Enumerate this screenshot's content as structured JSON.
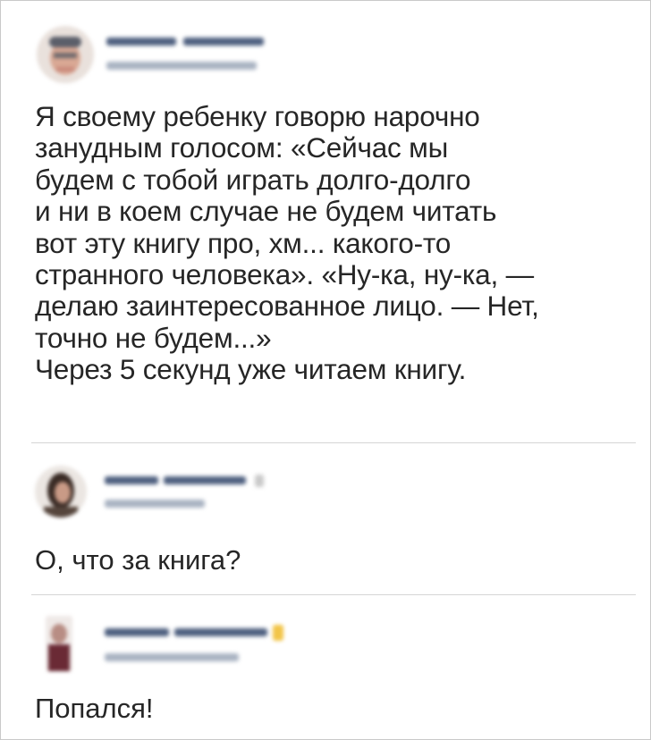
{
  "post": {
    "text_lines": [
      "Я своему ребенку говорю нарочно",
      "занудным голосом: «Сейчас мы",
      "будем с тобой играть долго-долго",
      "и ни в коем случае не будем читать",
      "вот эту книгу про, хм... какого-то",
      "странного человека». «Ну-ка, ну-ка, —",
      "делаю заинтересованное лицо. — Нет,",
      "точно не будем...»",
      "Через 5 секунд уже читаем книгу."
    ]
  },
  "comments": [
    {
      "text": "О, что за книга?"
    },
    {
      "text": "Попался!"
    }
  ],
  "colors": {
    "name_blur": "#4d5f7f",
    "meta_blur": "#a9b3c2",
    "badge": "#f2c54a",
    "divider": "#d5d5d5",
    "text": "#262626"
  },
  "icons": {
    "post_avatar": "user-avatar-icon",
    "comment1_avatar": "user-avatar-icon",
    "comment2_avatar": "user-avatar-icon",
    "comment2_badge": "badge-icon"
  }
}
